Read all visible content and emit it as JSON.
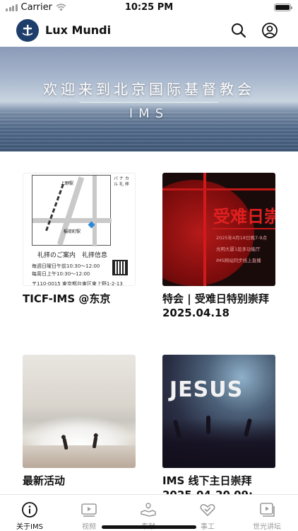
{
  "status_bar": {
    "carrier": "Carrier",
    "time": "10:25 PM",
    "icons": [
      "signal-icon",
      "wifi-icon",
      "battery-icon"
    ]
  },
  "header": {
    "app_title": "Lux Mundi",
    "logo_icon": "cross-logo-icon",
    "icons": [
      "search-icon",
      "profile-icon"
    ]
  },
  "banner": {
    "title": "欢迎来到北京国际基督教会",
    "subtitle": "IMS"
  },
  "cards": [
    {
      "title": "TICF-IMS @东京",
      "image": {
        "station_1": "上野駅",
        "station_2": "稲荷町駅",
        "vertical_text": "バ ナ カ ル 礼 拝",
        "caption": "礼拝のご案内　礼拝信息",
        "line_1": "毎週日曜日午前10:30～12:00",
        "line_2": "每周日上午10:30～12:00",
        "address": "〒110-0015 東京都台東区東上野1-2-13"
      }
    },
    {
      "title": "特会 | 受难日特别崇拜 2025.04.18",
      "image": {
        "headline": "受难日崇",
        "line_1": "2025年4月18日晚7-9点",
        "line_2": "光明大厦1层多功能厅",
        "line_3": "IMS网站同步线上直播"
      }
    },
    {
      "title": "最新活动",
      "image": {}
    },
    {
      "title": "IMS 线下主日崇拜 2025-04-20 09:",
      "image": {
        "headline": "JESUS"
      }
    }
  ],
  "tabs": [
    {
      "label": "关于IMS",
      "icon": "info-icon",
      "active": true
    },
    {
      "label": "视频",
      "icon": "video-icon",
      "active": false
    },
    {
      "label": "奉献",
      "icon": "giving-hand-icon",
      "active": false
    },
    {
      "label": "事工",
      "icon": "ministry-heart-icon",
      "active": false
    },
    {
      "label": "世光讲坛",
      "icon": "sermon-play-icon",
      "active": false
    }
  ],
  "colors": {
    "logo_bg": "#1d3d6b",
    "active_tab": "#111111",
    "inactive_tab": "#9a9a9a"
  }
}
